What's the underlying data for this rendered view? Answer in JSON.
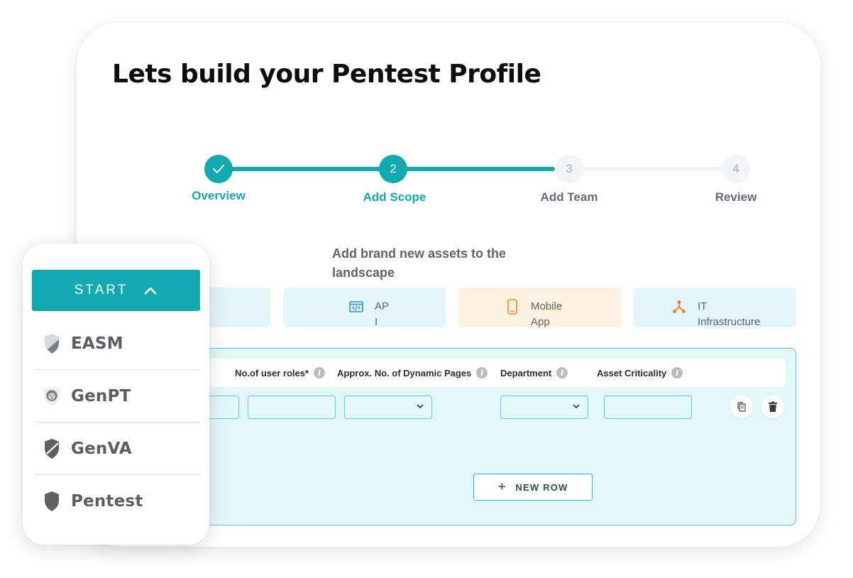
{
  "page": {
    "title": "Lets build your Pentest Profile"
  },
  "stepper": {
    "steps": [
      {
        "number": "",
        "label": "Overview",
        "state": "done"
      },
      {
        "number": "2",
        "label": "Add Scope",
        "state": "active"
      },
      {
        "number": "3",
        "label": "Add Team",
        "state": "todo"
      },
      {
        "number": "4",
        "label": "Review",
        "state": "todo"
      }
    ]
  },
  "scope": {
    "heading": "Add brand new assets to the landscape",
    "asset_types": [
      {
        "label": "",
        "icon": "none",
        "color": "#e2f5f8"
      },
      {
        "label_line1": "AP",
        "label_line2": "I",
        "icon": "api-code-icon",
        "color": "#e2f5f8"
      },
      {
        "label_line1": "Mobile",
        "label_line2": "App",
        "icon": "mobile-phone-icon",
        "color": "#fdf1df"
      },
      {
        "label_line1": "IT",
        "label_line2": "Infrastructure",
        "icon": "network-nodes-icon",
        "color": "#e2f5f8"
      }
    ]
  },
  "table": {
    "columns": [
      {
        "label": "No.of user roles*"
      },
      {
        "label": "Approx. No. of Dynamic Pages"
      },
      {
        "label": "Department"
      },
      {
        "label": "Asset Criticality"
      }
    ],
    "new_row_label": "NEW ROW"
  },
  "sidebar": {
    "start_label": "START",
    "items": [
      {
        "label": "EASM",
        "icon": "easm-shield-icon"
      },
      {
        "label": "GenPT",
        "icon": "lion-shield-icon"
      },
      {
        "label": "GenVA",
        "icon": "genva-shield-icon"
      },
      {
        "label": "Pentest",
        "icon": "pentest-shield-icon"
      }
    ]
  },
  "colors": {
    "accent": "#12a9b0",
    "panel": "#e2f7f8",
    "orange": "#f7923a"
  }
}
